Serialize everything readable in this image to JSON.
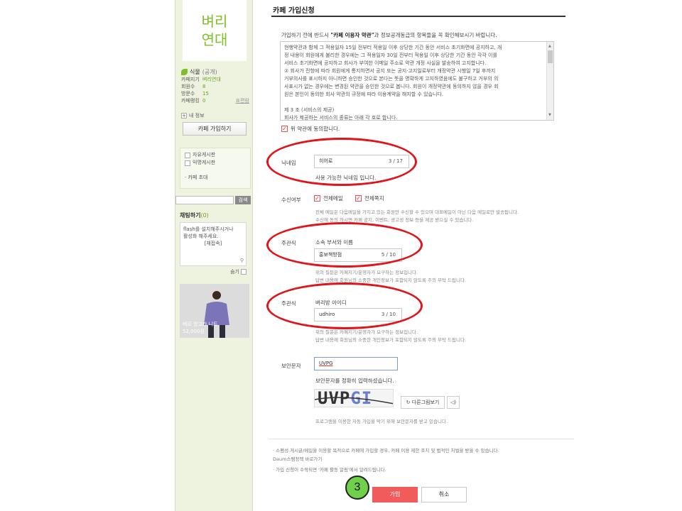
{
  "sidebar": {
    "logo": "벼리\n연대",
    "level": "식물",
    "visibility": "(공개)",
    "info_rows": [
      {
        "key": "카페지기",
        "value": "벼리연대"
      },
      {
        "key": "회원수",
        "value": "8"
      },
      {
        "key": "방문수",
        "value": "15"
      },
      {
        "key": "카페랭킹",
        "value": "0"
      }
    ],
    "rank_link": "표편람",
    "my_info": "내 정보",
    "join_button": "카페 가입하기",
    "boards": [
      "자유게시판",
      "익명게시판"
    ],
    "invite": "카페 초대",
    "search_button": "검색",
    "chat": {
      "title": "채팅하기",
      "count": "(0)",
      "message": "flash를 설치해주시거나\n활성화 해주세요.",
      "retry": "[재접속]",
      "hide": "숨기"
    },
    "ad": {
      "name": "베르 앙고라 니트",
      "price": "52,000원"
    }
  },
  "main": {
    "title": "카페 가입신청",
    "intro_pre": "가입하기 전에 반드시 ",
    "intro_bold": "\"카페 이용자 약관\"",
    "intro_post": "과 정보공개동급의 항목들을 꼭 확인해보시기 바랍니다.",
    "terms_text": "현행약관과 함께 그 적용일자 15일 전부터 적용일 이후 상당한 기간 동안 서비스 초기화면에 공지하고, 개\n정 내용이 회원에게 불리한 경우에는 그 적용일자 30일 전부터 적용일 이후 상당한 기간 동안 각각 이를\n서비스 초기화면에 공지하고 회사가 부여한 이메일 주소로 약관 개정 사실을 발송하여 고지합니다.\n② 회사가 전항에 따라 회원에게 통지하면서 공지 또는 공지·고지일로부터 개정약관 시행일 7일 후까지\n거부의사를 표시하지 아니하면 승인한 것으로 본다는 뜻을 명확하게 고지하였음에도 불구하고 거부의 의\n사표시가 없는 경우에는 변경된 약관을 승인한 것으로 봅니다. 회원이 개정약관에 동의하지 않을 경우 회\n원은 본인이 동의한 회사 약관의 규정에 따라 이용계약을 해지할 수 있습니다.\n\n제 3 조 (서비스의 제공)\n회사가 제공하는 서비스의 종류는 아래 각 호로 합니다.",
    "agree_label": "위 약관에 동의합니다.",
    "nickname": {
      "label": "닉네임",
      "value": "히어로",
      "count": "3 / 17",
      "status": "사용 가능한 닉네임 입니다."
    },
    "receive": {
      "label": "수신여부",
      "option_mail": "전체메일",
      "option_note": "전체쪽지",
      "note": "전체 메일은 다음메일을 가지고 있는 회원만 수신할 수 있으며 대표메일이 아닌 다음 메일로만 발송됩니다.\n수신에 동의 하시면 카페 공지, 이벤트, 광고성 정보 등을 제공 받으실 수 있습니다."
    },
    "q1": {
      "label": "주관식",
      "question": "소속 부서와 이름",
      "value": "홍보책방점",
      "count": "5 / 10",
      "note": "위의 질문은 카페지기/운영자가 요구하는 정보입니다.\n답변 내용에 회원님의 소중한 개인정보가 포함되지 않도록 주의 부탁 드립니다."
    },
    "q2": {
      "label": "주관식",
      "question": "벼리방 아이디",
      "value": "udhiro",
      "count": "3 / 10",
      "note": "위의 질문은 카페지기/운영자가 요구하는 정보입니다.\n답변 내용에 회원님의 소중한 개인정보가 포함되지 않도록 주의 부탁 드립니다."
    },
    "captcha": {
      "label": "보안문자",
      "value": "UVPG",
      "instruction": "보안문자를 정확히 입력하셨습니다.",
      "image_text_a": "UVP",
      "image_text_b": "GI",
      "refresh": "다른그림보기",
      "sound": "◁)",
      "note": "프로그램을 이용한 자동 가입을 막기 위해 보안문자를 받고 있습니다."
    },
    "bullets": [
      "· 스팸성 게시글/메일을 이용할 목적으로 카페에 가입할 경우, 카페 이용 제한 조치 및 법적인 처벌을 받을 수 있습니다.",
      "   Daum스팸정책 바로가기",
      "· 가입 신청이 수락되면 '카페 활동 알림'에서 알려드립니다."
    ],
    "join_button": "가입",
    "cancel_button": "취소",
    "step_badge": "3"
  },
  "colors": {
    "accent_green": "#7fbf2a",
    "join_red": "#f25b5b",
    "highlight_ring": "#e0141b",
    "step_badge": "#6fd14a"
  }
}
